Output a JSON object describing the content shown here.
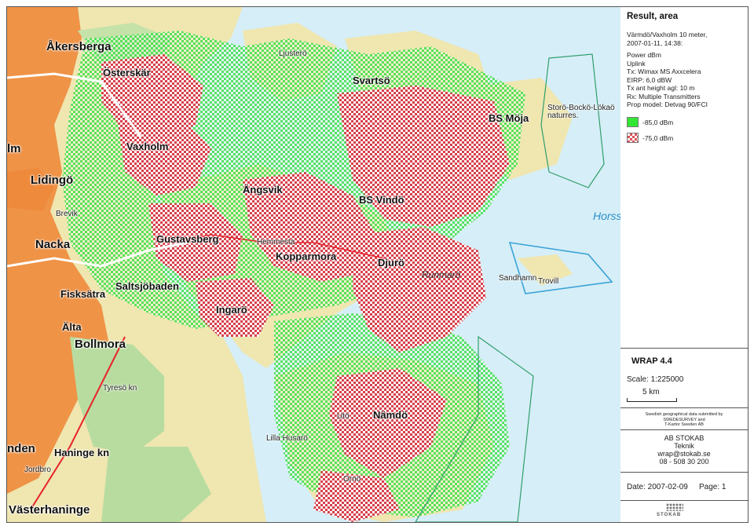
{
  "legend": {
    "title": "Result, area",
    "subtitle_line1": "Värmdö/Vaxholm 10 meter,",
    "subtitle_line2": "2007-01-11, 14:38:",
    "params": [
      "Power dBm",
      "Uplink",
      "Tx: Wimax MS Axxcelera",
      "EIRP: 6,0 dBW",
      "Tx ant height agl: 10 m",
      "Rx: Multiple Transmitters",
      "Prop model: Detvag 90/FCI"
    ],
    "levels": [
      {
        "label": "-85,0 dBm",
        "color": "#33e633"
      },
      {
        "label": "-75,0 dBm",
        "color": "#d9525a"
      }
    ],
    "app": "WRAP 4.4",
    "scale": "Scale: 1:225000",
    "scalebar_label": "5 km",
    "credit_line1": "Swedish geographical data submitted by",
    "credit_line2": "SWEDESURVEY and",
    "credit_line3": "T-Kartor Sweden AB",
    "company": "AB STOKAB",
    "dept": "Teknik",
    "email": "wrap@stokab.se",
    "phone": "08 - 508 30 200",
    "date": "Date: 2007-02-09",
    "page": "Page: 1",
    "logo_text": "STOKAB"
  },
  "map": {
    "base_stations": [
      "Österskär",
      "Svartsö",
      "BS Möja",
      "Vaxholm",
      "Ängsvik",
      "BS Vindö",
      "Gustavsberg",
      "Kopparmora",
      "Djurö",
      "Ingarö",
      "Nämdö"
    ],
    "places": [
      "Åkersberga",
      "Lidingö",
      "Nacka",
      "Saltsjöbaden",
      "Fisksätra",
      "Älta",
      "Bollmora",
      "Tyresö kn",
      "Haninge kn",
      "Jordbro",
      "Västerhaninge",
      "nden",
      "lm",
      "Brevik",
      "Hemmesta",
      "Runmarö",
      "Sandhamn",
      "Trovill",
      "Storö-Bockö-Lökaö naturres.",
      "Ljusterö",
      "Ornö",
      "Utö",
      "Lilla Husarö"
    ],
    "water": [
      "Horss"
    ],
    "colors": {
      "land": "#efe6b0",
      "water": "#d6eef7",
      "urban": "#ee8a3c",
      "forest": "#b8dca0"
    }
  }
}
